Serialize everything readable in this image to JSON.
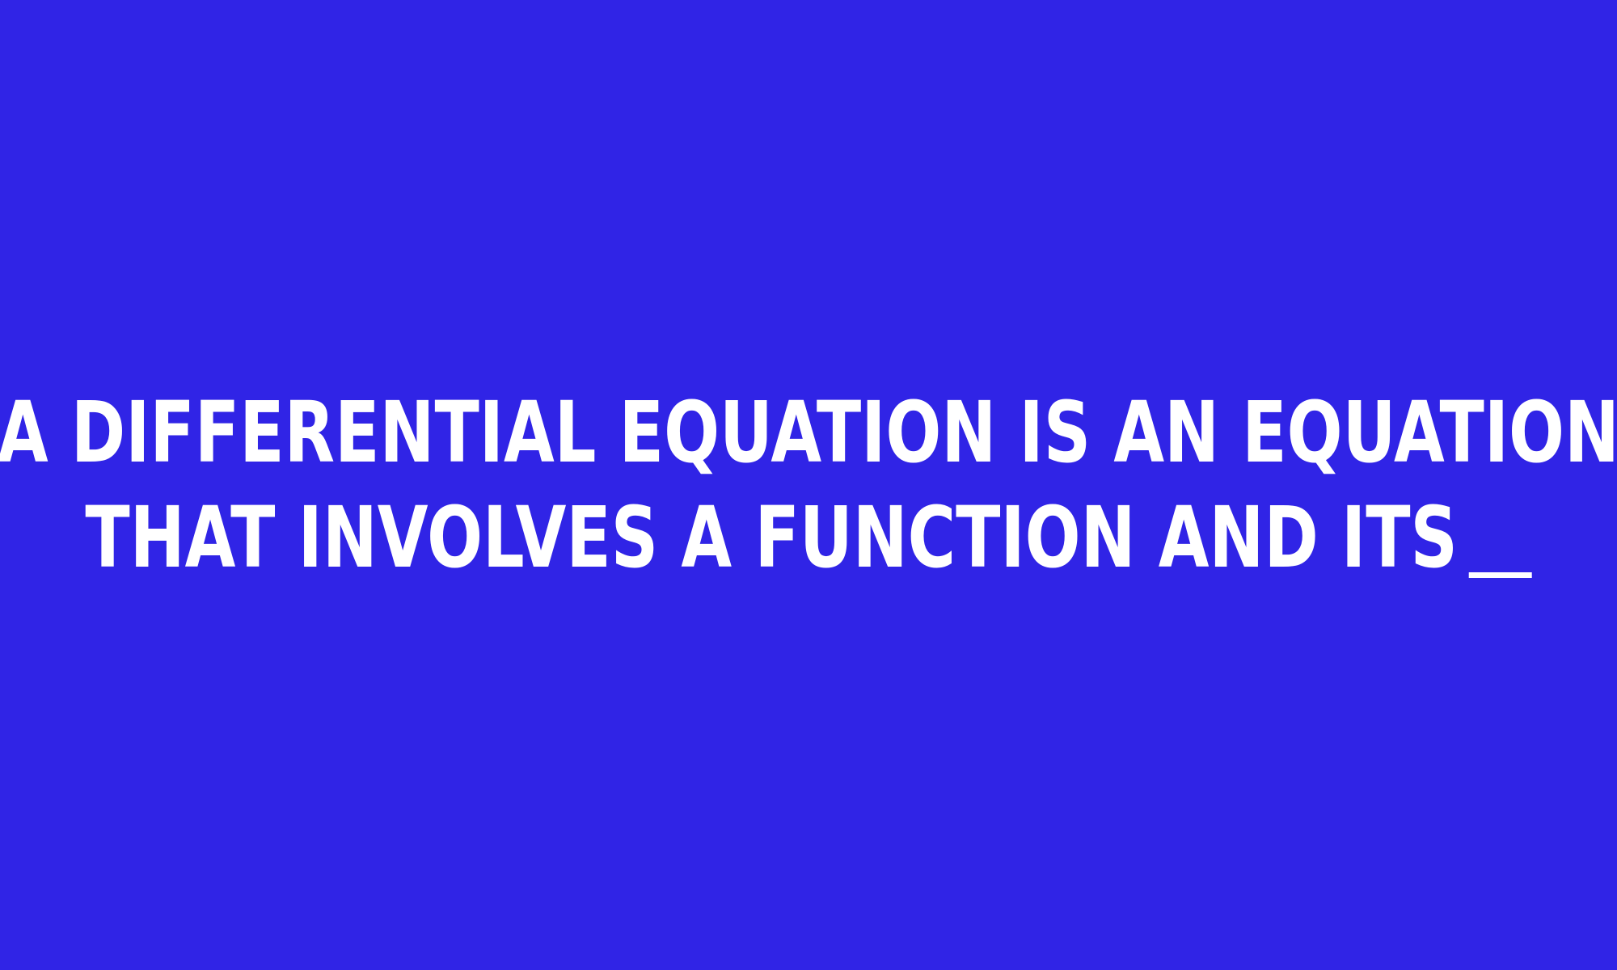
{
  "question": {
    "line1": "A DIFFERENTIAL EQUATION IS AN EQUATION",
    "line2": "THAT INVOLVES A FUNCTION AND ITS",
    "blank": "__"
  },
  "colors": {
    "background": "#3024e6",
    "text": "#ffffff"
  }
}
